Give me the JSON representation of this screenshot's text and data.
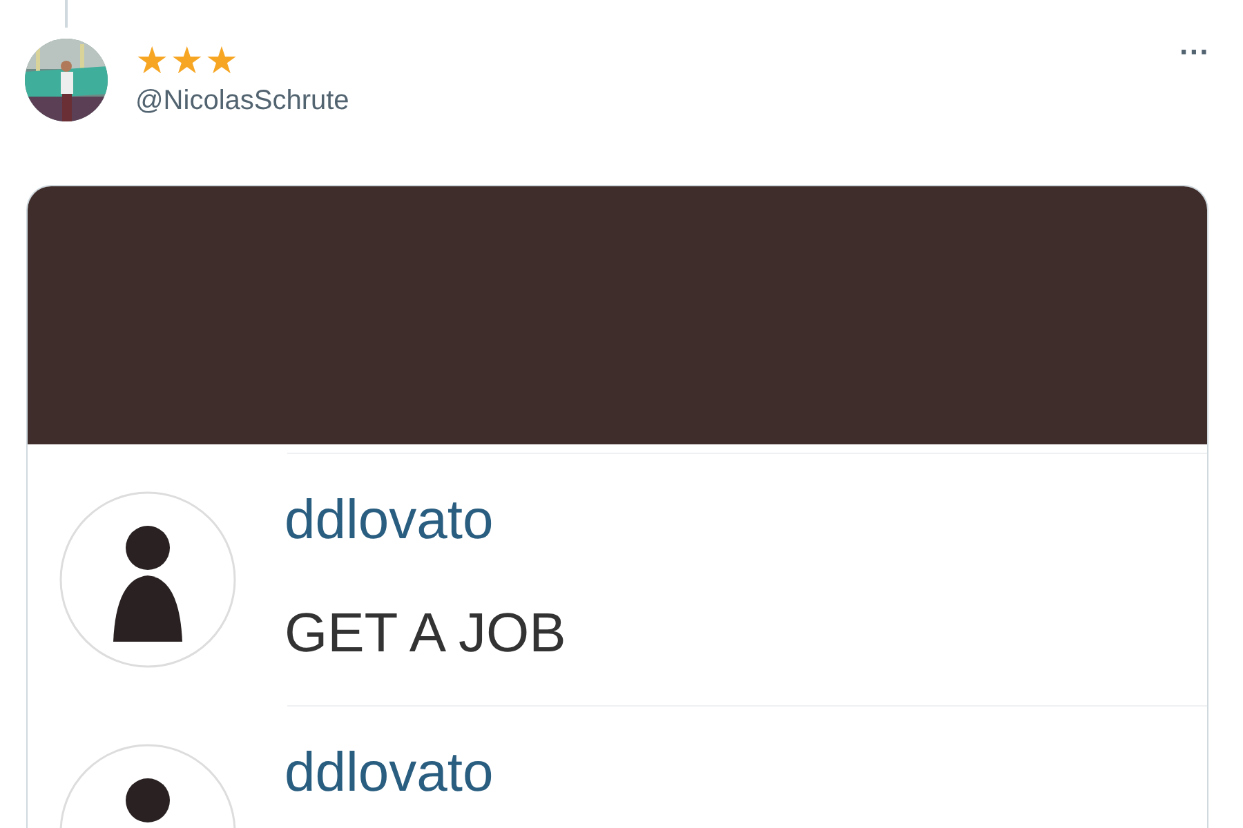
{
  "tweet": {
    "display_name": "★★★",
    "handle": "@NicolasSchrute",
    "more": "···",
    "media": {
      "kind": "screenshot",
      "comments": [
        {
          "username": "ddlovato",
          "text": "GET A JOB"
        },
        {
          "username": "ddlovato"
        }
      ]
    }
  }
}
